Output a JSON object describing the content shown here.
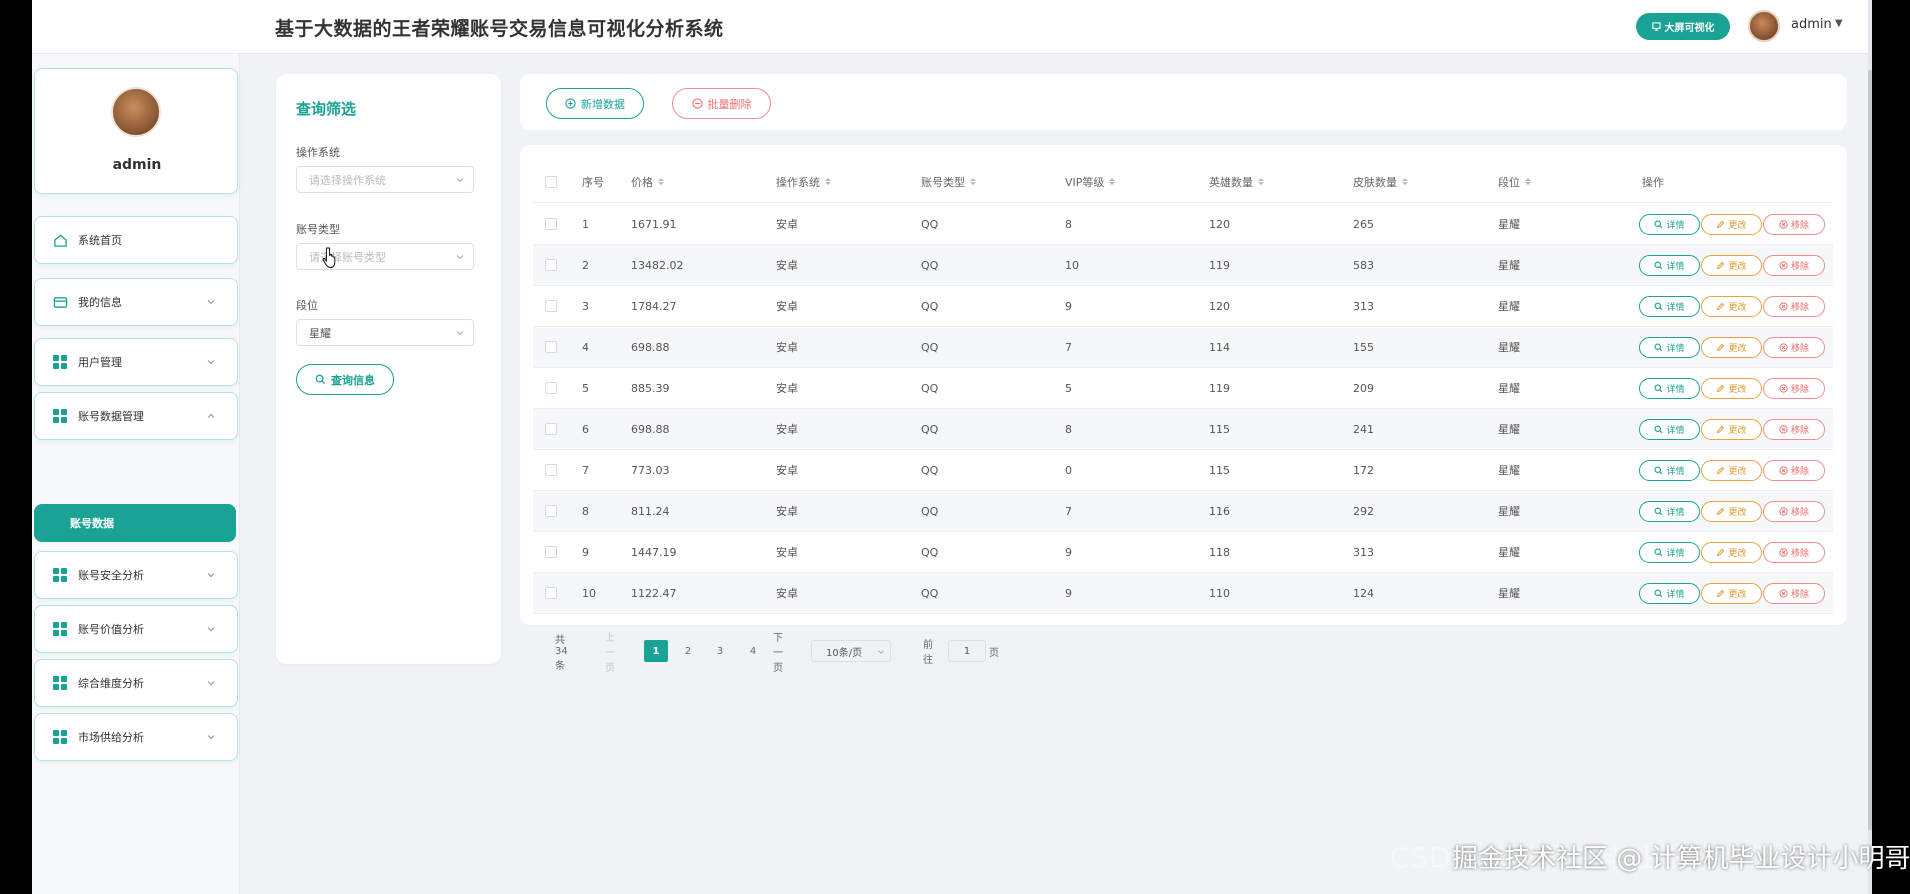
{
  "header": {
    "title": "基于大数据的王者荣耀账号交易信息可视化分析系统",
    "bigscreen_label": "大屏可视化",
    "username": "admin"
  },
  "sidebar": {
    "profile_name": "admin",
    "items": [
      {
        "label": "系统首页"
      },
      {
        "label": "我的信息"
      },
      {
        "label": "用户管理"
      },
      {
        "label": "账号数据管理"
      },
      {
        "label": "账号数据"
      },
      {
        "label": "账号安全分析"
      },
      {
        "label": "账号价值分析"
      },
      {
        "label": "综合维度分析"
      },
      {
        "label": "市场供给分析"
      }
    ]
  },
  "filter": {
    "title": "查询筛选",
    "os_label": "操作系统",
    "os_placeholder": "请选择操作系统",
    "type_label": "账号类型",
    "type_placeholder": "请选择账号类型",
    "rank_label": "段位",
    "rank_value": "星耀",
    "query_label": "查询信息"
  },
  "actions": {
    "add_label": "新增数据",
    "batch_delete_label": "批量删除"
  },
  "table": {
    "headers": [
      "序号",
      "价格",
      "操作系统",
      "账号类型",
      "VIP等级",
      "英雄数量",
      "皮肤数量",
      "段位",
      "操作"
    ],
    "buttons": {
      "detail": "详情",
      "edit": "更改",
      "remove": "移除"
    },
    "rows": [
      [
        "1",
        "1671.91",
        "安卓",
        "QQ",
        "8",
        "120",
        "265",
        "星耀"
      ],
      [
        "2",
        "13482.02",
        "安卓",
        "QQ",
        "10",
        "119",
        "583",
        "星耀"
      ],
      [
        "3",
        "1784.27",
        "安卓",
        "QQ",
        "9",
        "120",
        "313",
        "星耀"
      ],
      [
        "4",
        "698.88",
        "安卓",
        "QQ",
        "7",
        "114",
        "155",
        "星耀"
      ],
      [
        "5",
        "885.39",
        "安卓",
        "QQ",
        "5",
        "119",
        "209",
        "星耀"
      ],
      [
        "6",
        "698.88",
        "安卓",
        "QQ",
        "8",
        "115",
        "241",
        "星耀"
      ],
      [
        "7",
        "773.03",
        "安卓",
        "QQ",
        "0",
        "115",
        "172",
        "星耀"
      ],
      [
        "8",
        "811.24",
        "安卓",
        "QQ",
        "7",
        "116",
        "292",
        "星耀"
      ],
      [
        "9",
        "1447.19",
        "安卓",
        "QQ",
        "9",
        "118",
        "313",
        "星耀"
      ],
      [
        "10",
        "1122.47",
        "安卓",
        "QQ",
        "9",
        "110",
        "124",
        "星耀"
      ]
    ]
  },
  "pagination": {
    "total": "共 34 条",
    "prev": "上一页",
    "pages": [
      "1",
      "2",
      "3",
      "4"
    ],
    "current": "1",
    "next": "下一页",
    "page_size": "10条/页",
    "goto_prefix": "前往",
    "goto_value": "1",
    "goto_suffix": "页"
  },
  "watermark": {
    "back": "CSDN @计算机毕业设计小明哥",
    "front": "掘金技术社区 @ 计算机毕业设计小明哥"
  },
  "colors": {
    "accent": "#1aa394",
    "warning": "#e39a2d",
    "danger": "#ea6d6d"
  }
}
